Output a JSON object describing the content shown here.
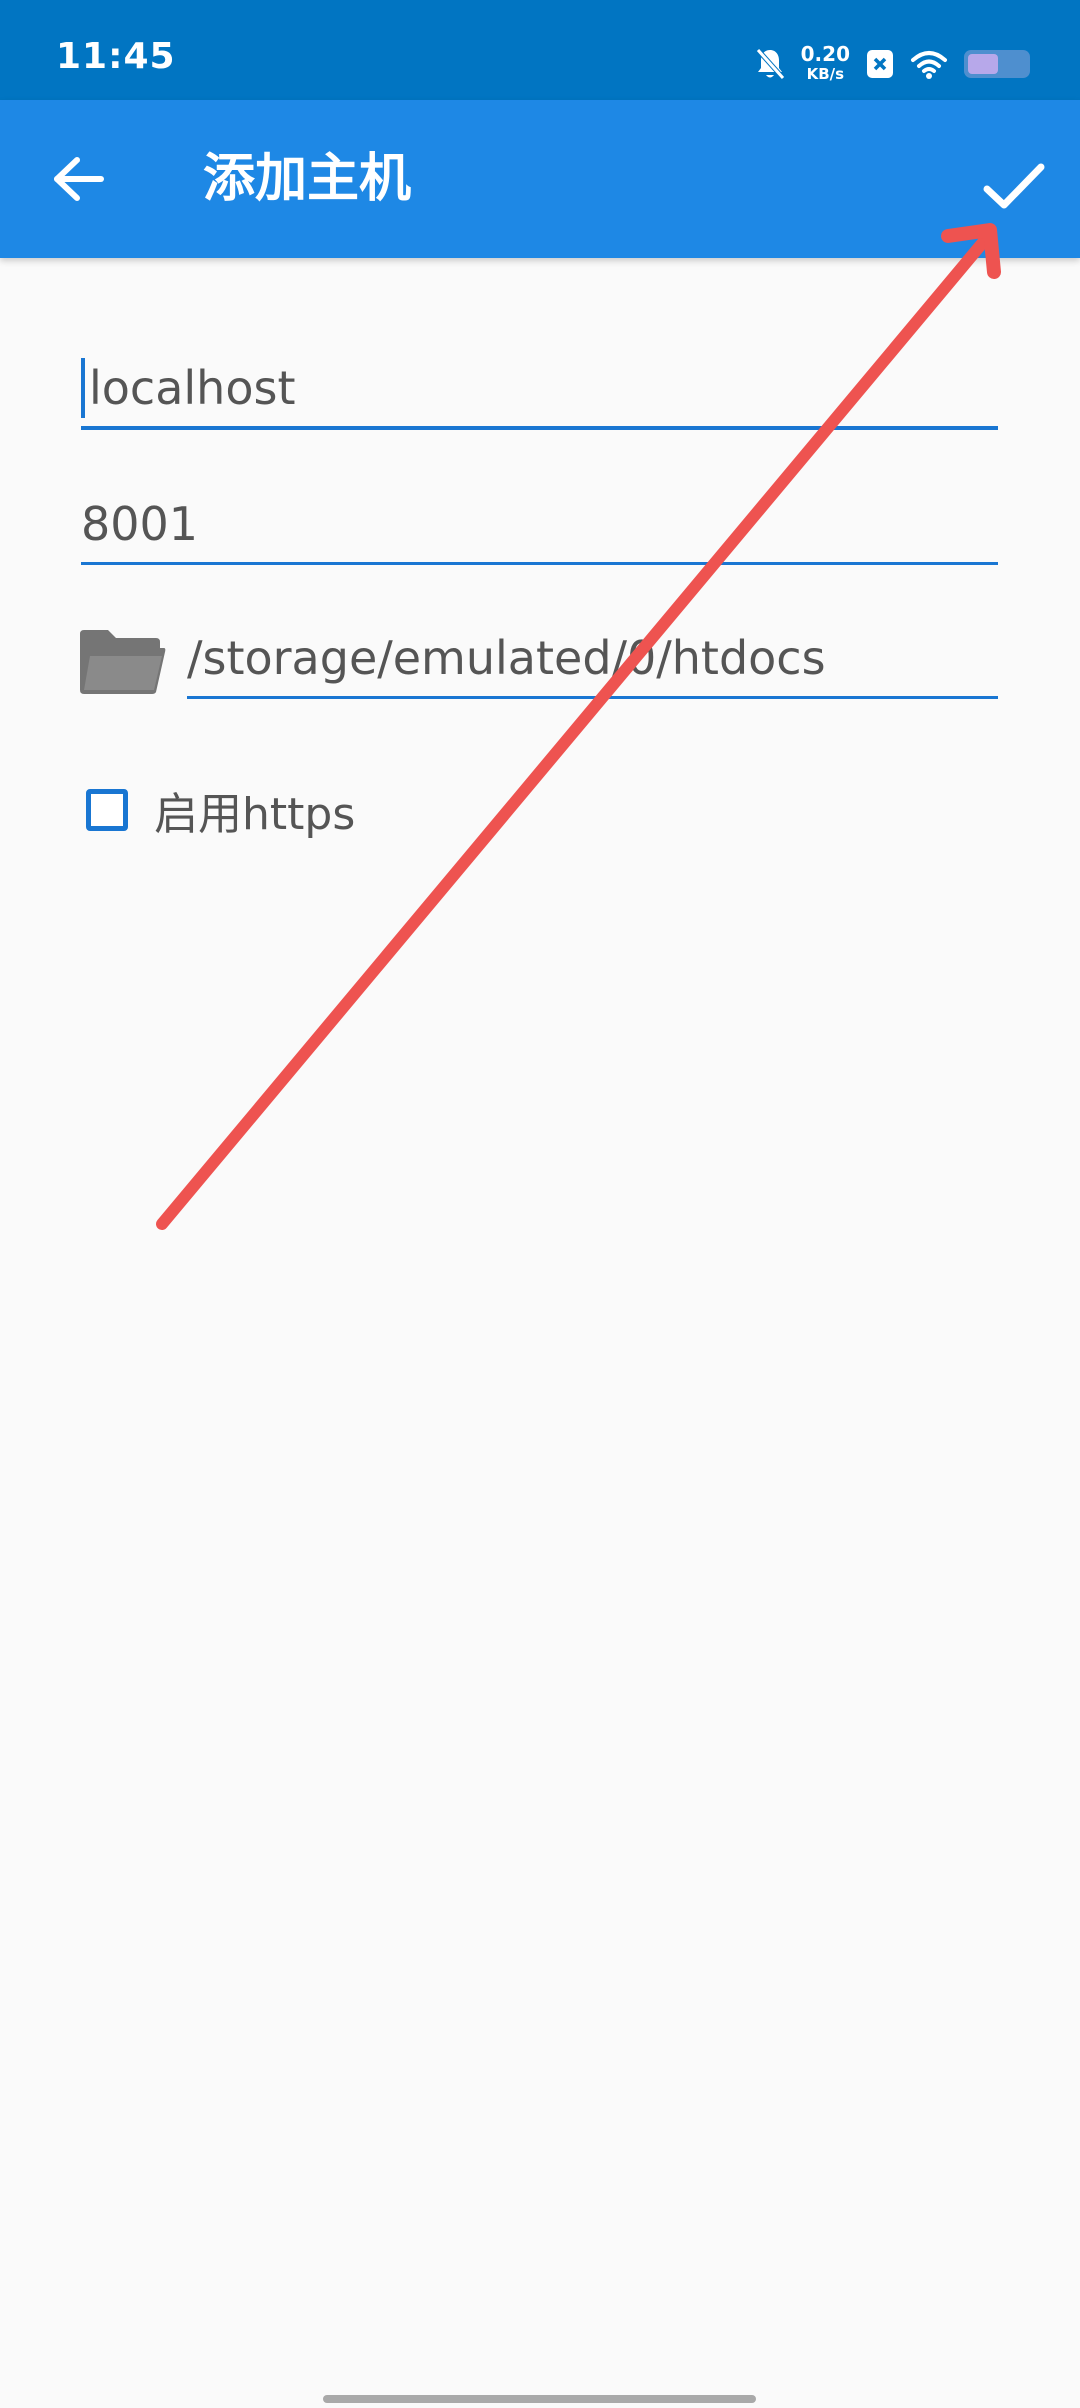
{
  "status_bar": {
    "time": "11:45",
    "network_speed_value": "0.20",
    "network_speed_unit": "KB/s",
    "icons": [
      "bell-muted-icon",
      "close-box-icon",
      "wifi-icon",
      "battery-icon"
    ]
  },
  "app_bar": {
    "title": "添加主机",
    "back_icon": "arrow-left-icon",
    "confirm_icon": "check-icon"
  },
  "form": {
    "host_value": "localhost",
    "port_value": "8001",
    "path_value": "/storage/emulated/0/htdocs",
    "folder_icon": "folder-icon",
    "https_label": "启用https",
    "https_checked": false
  },
  "colors": {
    "status_bar": "#0175c2",
    "app_bar": "#1e88e5",
    "accent": "#1976d2",
    "background": "#fafafa",
    "text": "#555555",
    "annotation": "#ee5350"
  }
}
